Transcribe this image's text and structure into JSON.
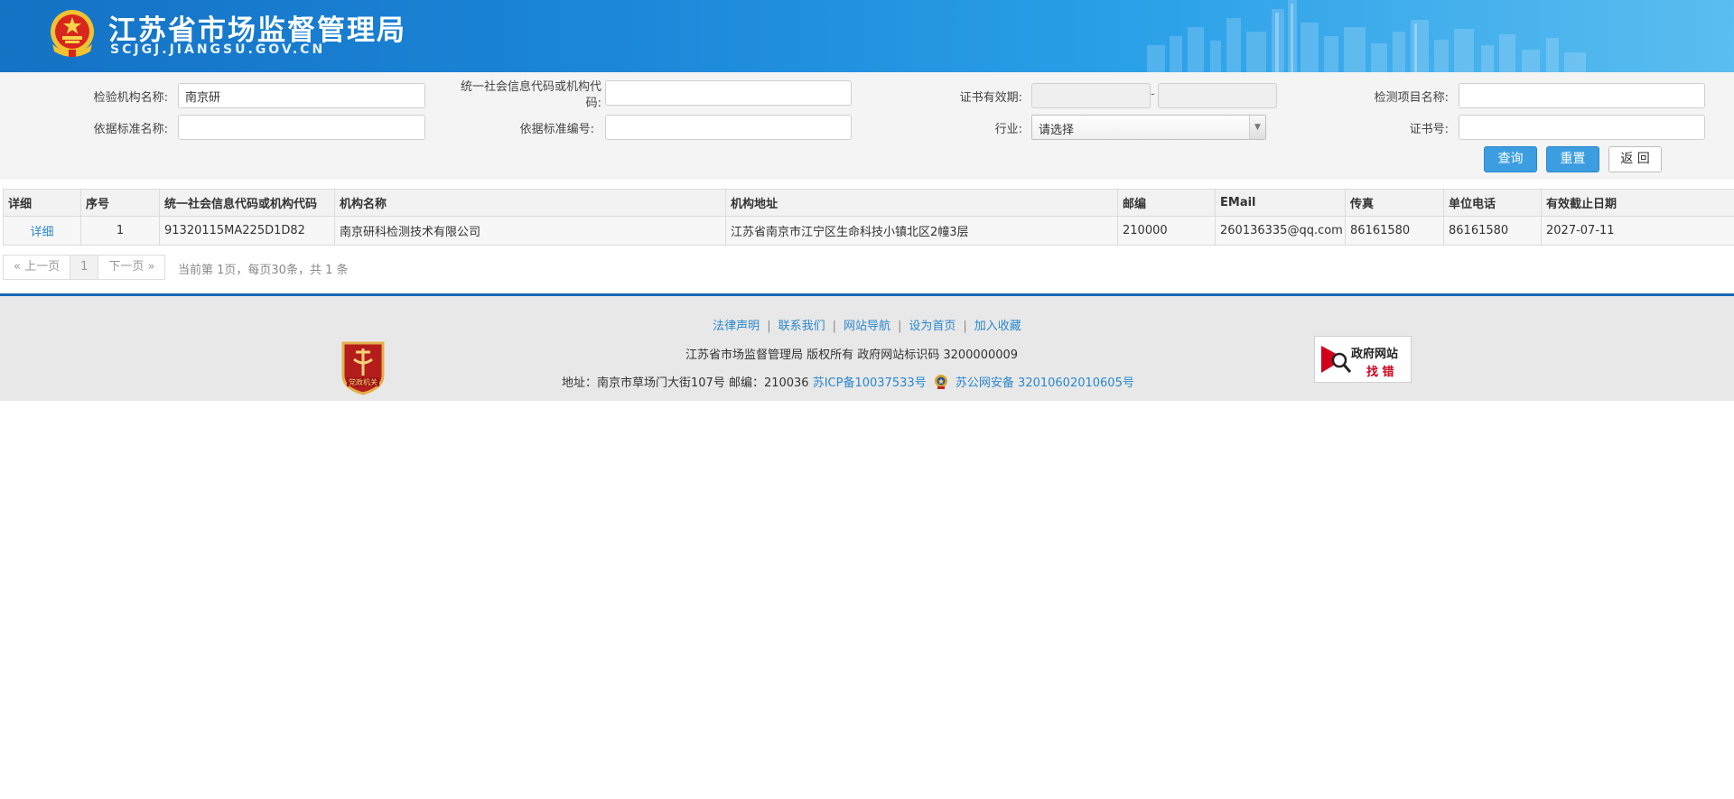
{
  "header": {
    "title": "江苏省市场监督管理局",
    "subtitle": "SCJGJ.JIANGSU.GOV.CN"
  },
  "search": {
    "org_name_label": "检验机构名称:",
    "org_name_value": "南京研",
    "credit_code_label_line1": "统一社会信息代码或机构代",
    "credit_code_label_line2": "码:",
    "credit_code_value": "",
    "cert_valid_label": "证书有效期:",
    "cert_valid_dash": "-",
    "test_item_label": "检测项目名称:",
    "standard_name_label": "依据标准名称:",
    "standard_no_label": "依据标准编号:",
    "industry_label": "行业:",
    "industry_selected": "请选择",
    "cert_no_label": "证书号:",
    "query_button": "查询",
    "reset_button": "重置",
    "back_button": "返 回"
  },
  "table": {
    "columns": [
      "详细",
      "序号",
      "统一社会信息代码或机构代码",
      "机构名称",
      "机构地址",
      "邮编",
      "EMail",
      "传真",
      "单位电话",
      "有效截止日期"
    ],
    "rows": [
      {
        "detail": "详细",
        "index": "1",
        "code": "91320115MA225D1D82",
        "name": "南京研科检测技术有限公司",
        "address": "江苏省南京市江宁区生命科技小镇北区2幢3层",
        "zip": "210000",
        "email": "260136335@qq.com",
        "fax": "86161580",
        "phone": "86161580",
        "expire": "2027-07-11"
      }
    ]
  },
  "pager": {
    "prev": "« 上一页",
    "current": "1",
    "next": "下一页 »",
    "info": "当前第 1页，每页30条，共 1 条"
  },
  "footer": {
    "links": [
      "法律声明",
      "联系我们",
      "网站导航",
      "设为首页",
      "加入收藏"
    ],
    "separator": "|",
    "copyright": "江苏省市场监督管理局 版权所有 政府网站标识码 3200000009",
    "address": "地址：南京市草场门大街107号 邮编：210036",
    "icp": "苏ICP备10037533号",
    "police": "苏公网安备 32010602010605号",
    "badge_text": "党政机关",
    "gov_error_line1": "政府网站",
    "gov_error_line2": "找 错"
  },
  "colors": {
    "header_blue": "#1b86d8",
    "button_blue": "#3c9ee0",
    "link_blue": "#2a88cc",
    "footer_line": "#1567b8"
  }
}
